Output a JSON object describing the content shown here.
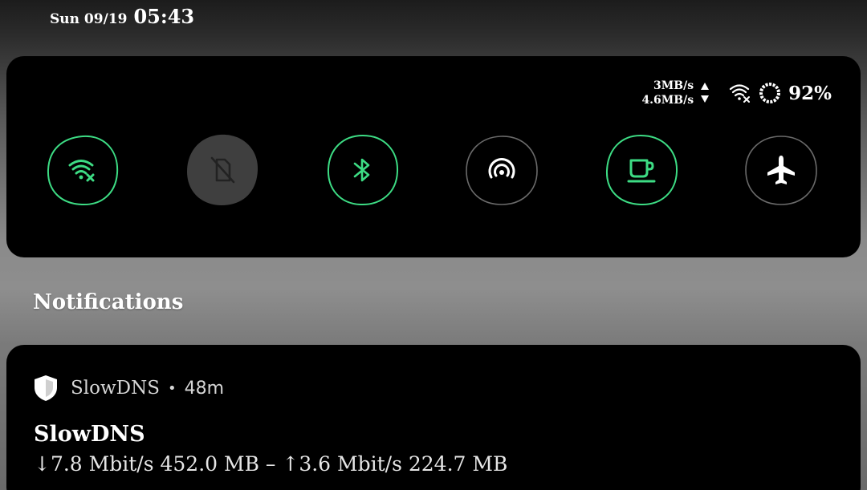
{
  "status_bar": {
    "date": "Sun 09/19",
    "time": "05:43"
  },
  "quick_settings": {
    "upload_speed": "3MB/s",
    "download_speed": "4.6MB/s",
    "battery_percent": "92%",
    "accent_color": "#3ddc84",
    "tiles": [
      {
        "name": "Wi-Fi",
        "icon": "wifi-off-icon",
        "state": "active"
      },
      {
        "name": "Mobile data",
        "icon": "mobile-data-off-icon",
        "state": "unavailable"
      },
      {
        "name": "Bluetooth",
        "icon": "bluetooth-icon",
        "state": "active"
      },
      {
        "name": "Hotspot",
        "icon": "hotspot-icon",
        "state": "inactive"
      },
      {
        "name": "Caffeine",
        "icon": "coffee-cup-icon",
        "state": "active"
      },
      {
        "name": "Airplane mode",
        "icon": "airplane-icon",
        "state": "inactive"
      }
    ]
  },
  "notifications": {
    "heading": "Notifications",
    "items": [
      {
        "app_name": "SlowDNS",
        "separator": "•",
        "time": "48m",
        "title": "SlowDNS",
        "body": "↓7.8 Mbit/s 452.0 MB – ↑3.6 Mbit/s 224.7 MB"
      }
    ]
  }
}
